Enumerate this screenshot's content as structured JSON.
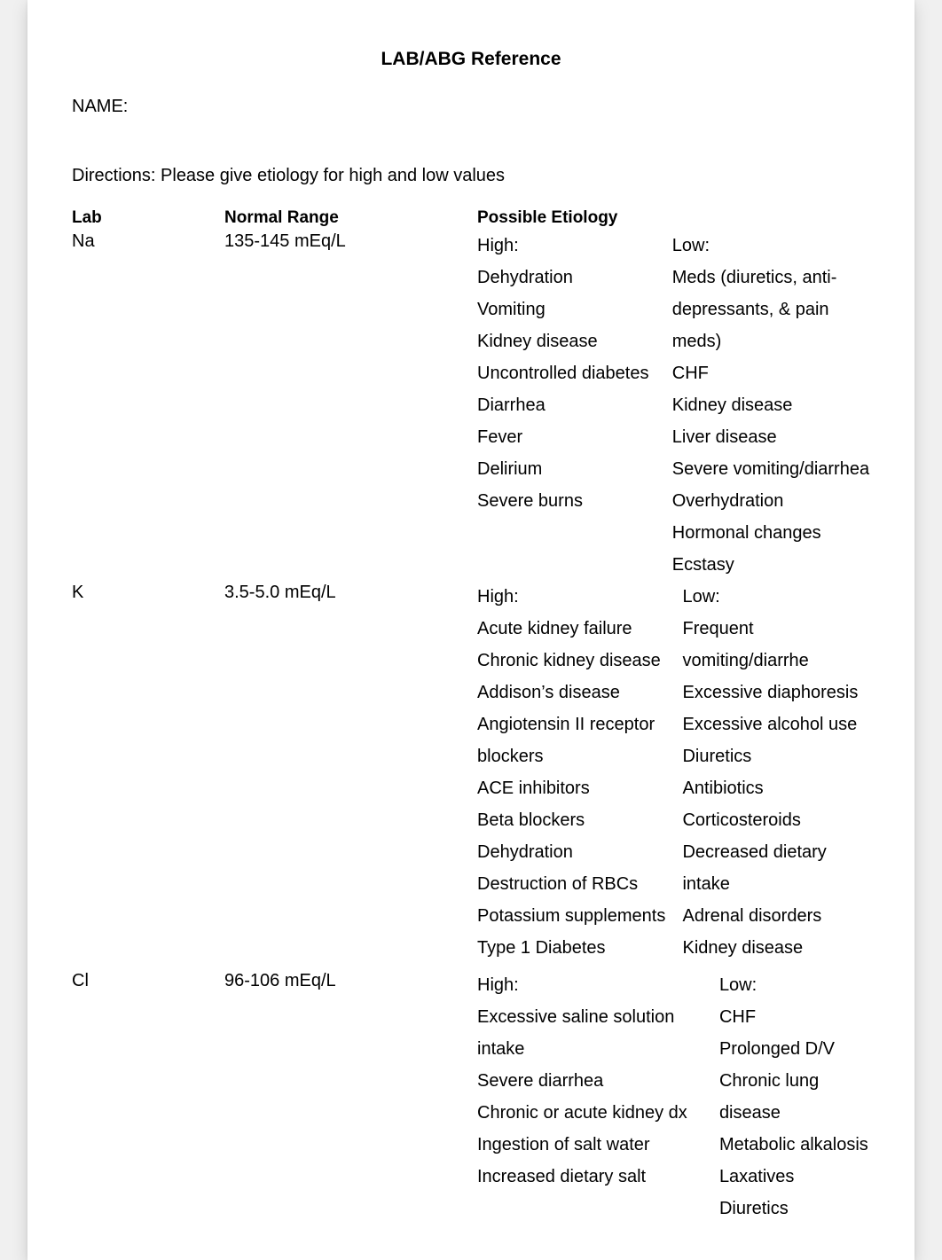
{
  "title": "LAB/ABG Reference",
  "name_label": "NAME:",
  "directions": "Directions: Please give etiology for high and low values",
  "headers": {
    "lab": "Lab",
    "range": "Normal Range",
    "etiology": "Possible Etiology"
  },
  "high_label": "High:",
  "low_label": "Low:",
  "rows": [
    {
      "lab": "Na",
      "range": "135-145 mEq/L",
      "high": [
        "Dehydration",
        "Vomiting",
        "Kidney disease",
        "Uncontrolled diabetes",
        "Diarrhea",
        "Fever",
        "Delirium",
        "Severe burns"
      ],
      "low": [
        "Meds (diuretics, anti-",
        "depressants, & pain meds)",
        "CHF",
        "Kidney disease",
        "Liver disease",
        "Severe vomiting/diarrhea",
        "Overhydration",
        "Hormonal changes",
        "Ecstasy"
      ]
    },
    {
      "lab": "K",
      "range": "3.5-5.0 mEq/L",
      "high": [
        "Acute kidney failure",
        "Chronic kidney disease",
        "Addison’s disease",
        "Angiotensin II receptor",
        "blockers",
        "ACE inhibitors",
        "Beta blockers",
        "Dehydration",
        "Destruction of RBCs",
        "Potassium supplements",
        "Type 1 Diabetes"
      ],
      "low": [
        "Frequent vomiting/diarrhe",
        "Excessive diaphoresis",
        "Excessive alcohol use",
        "Diuretics",
        "Antibiotics",
        "Corticosteroids",
        "Decreased dietary intake",
        "Adrenal disorders",
        "Kidney disease"
      ]
    },
    {
      "lab": "Cl",
      "range": "96-106 mEq/L",
      "high": [
        "Excessive saline solution",
        "intake",
        "Severe diarrhea",
        "Chronic or acute kidney dx",
        "Ingestion of salt water",
        "Increased dietary salt"
      ],
      "low": [
        "CHF",
        "Prolonged D/V",
        "Chronic lung disease",
        "Metabolic alkalosis",
        "Laxatives",
        "Diuretics"
      ]
    }
  ]
}
